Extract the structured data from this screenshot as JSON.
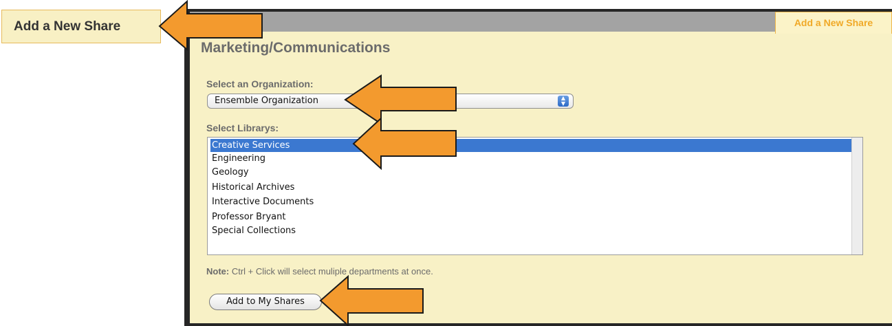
{
  "left_tab": {
    "label": "Add a New Share"
  },
  "panel": {
    "tab_label": "Add a New Share",
    "title": "Marketing/Communications"
  },
  "organization": {
    "label": "Select an Organization:",
    "selected": "Ensemble Organization"
  },
  "libraries": {
    "label": "Select Librarys:",
    "items": [
      {
        "label": "Creative Services",
        "selected": true
      },
      {
        "label": "Engineering",
        "selected": false
      },
      {
        "label": "Geology",
        "selected": false
      },
      {
        "label": "Historical Archives",
        "selected": false
      },
      {
        "label": "Interactive Documents",
        "selected": false
      },
      {
        "label": "Professor Bryant",
        "selected": false
      },
      {
        "label": "Special Collections",
        "selected": false
      }
    ]
  },
  "note": {
    "prefix": "Note:",
    "text": " Ctrl + Click will select muliple departments at once."
  },
  "add_button": {
    "label": "Add to My Shares"
  },
  "colors": {
    "panel_bg": "#f8f1c6",
    "accent": "#f0a927",
    "arrow_fill": "#f39a2e",
    "selection": "#3b78d0"
  },
  "annotation_arrows": [
    "left-tab-arrow",
    "organization-arrow",
    "library-arrow",
    "add-button-arrow"
  ]
}
